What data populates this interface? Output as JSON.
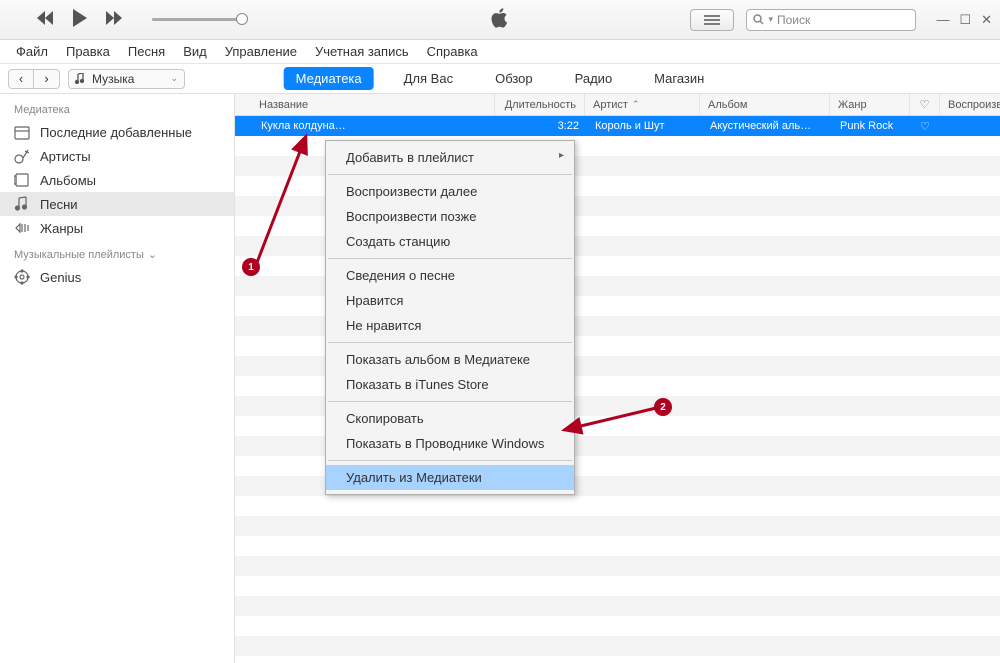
{
  "search_placeholder": "Поиск",
  "menu": [
    "Файл",
    "Правка",
    "Песня",
    "Вид",
    "Управление",
    "Учетная запись",
    "Справка"
  ],
  "media_selector": "Музыка",
  "tabs": [
    {
      "label": "Медиатека",
      "active": true
    },
    {
      "label": "Для Вас",
      "active": false
    },
    {
      "label": "Обзор",
      "active": false
    },
    {
      "label": "Радио",
      "active": false
    },
    {
      "label": "Магазин",
      "active": false
    }
  ],
  "sidebar": {
    "library_head": "Медиатека",
    "items": [
      {
        "label": "Последние добавленные"
      },
      {
        "label": "Артисты"
      },
      {
        "label": "Альбомы"
      },
      {
        "label": "Песни",
        "selected": true
      },
      {
        "label": "Жанры"
      }
    ],
    "playlists_head": "Музыкальные плейлисты",
    "genius": "Genius"
  },
  "columns": {
    "name": "Название",
    "duration": "Длительность",
    "artist": "Артист",
    "album": "Альбом",
    "genre": "Жанр",
    "play": "Воспроизвед"
  },
  "track": {
    "name": "Кукла колдуна…",
    "duration": "3:22",
    "artist": "Король и Шут",
    "album": "Акустический аль…",
    "genre": "Punk Rock"
  },
  "context_menu": {
    "add_to_playlist": "Добавить в плейлист",
    "play_next": "Воспроизвести далее",
    "play_later": "Воспроизвести позже",
    "create_station": "Создать станцию",
    "song_info": "Сведения о песне",
    "like": "Нравится",
    "dislike": "Не нравится",
    "show_album": "Показать альбом в Медиатеке",
    "show_itunes": "Показать в iTunes Store",
    "copy": "Скопировать",
    "show_windows": "Показать в Проводнике Windows",
    "delete": "Удалить из Медиатеки"
  },
  "annotations": {
    "a1": "1",
    "a2": "2"
  }
}
